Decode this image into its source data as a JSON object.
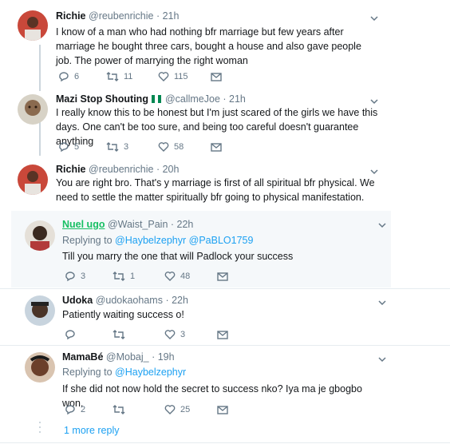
{
  "tweets": [
    {
      "name": "Richie",
      "handle": "@reubenrichie",
      "time": "· 21h",
      "text": "I know of a man who had nothing bfr marriage but few years after marriage he bought three cars, bought a house and also gave people job. The power of marrying the right woman",
      "replies": "6",
      "retweets": "11",
      "likes": "115"
    },
    {
      "name": "Mazi Stop Shouting",
      "handle": "@callmeJoe",
      "time": "· 21h",
      "text": "I really know this to be honest but I'm just scared of the girls we have this days. One can't be too sure, and being too careful doesn't guarantee anything",
      "replies": "5",
      "retweets": "3",
      "likes": "58"
    },
    {
      "name": "Richie",
      "handle": "@reubenrichie",
      "time": "· 20h",
      "text": "You are right bro. That's y marriage is first of all spiritual bfr physical. We need to settle the matter spiritually bfr going to physical manifestation."
    },
    {
      "name": "Nuel ugo",
      "handle": "@Waist_Pain",
      "time": "· 22h",
      "replying_label": "Replying to",
      "replying_to_1": "@Haybelzephyr",
      "replying_to_2": "@PaBLO1759",
      "text": "Till you marry the one that will Padlock your success",
      "replies": "3",
      "retweets": "1",
      "likes": "48"
    },
    {
      "name": "Udoka",
      "handle": "@udokaohams",
      "time": "· 22h",
      "text": "Patiently waiting success o!",
      "replies": "",
      "retweets": "",
      "likes": "3"
    },
    {
      "name": "MamaBé",
      "handle": "@Mobaj_",
      "time": "· 19h",
      "replying_label": "Replying to",
      "replying_to_1": "@Haybelzephyr",
      "text": "If she did not now hold the secret to success nko? Iya ma je gbogbo won.",
      "replies": "2",
      "retweets": "",
      "likes": "25"
    }
  ],
  "more_replies": "1 more reply",
  "colors": {
    "link": "#1da1f2",
    "muted": "#657786",
    "highlight_bg": "#f5f8fa",
    "nuel_name": "#17bf63"
  },
  "icons": {
    "reply": "reply-icon",
    "retweet": "retweet-icon",
    "like": "heart-icon",
    "dm": "envelope-icon",
    "menu": "chevron-down-icon",
    "flag": "nigeria-flag-icon"
  }
}
